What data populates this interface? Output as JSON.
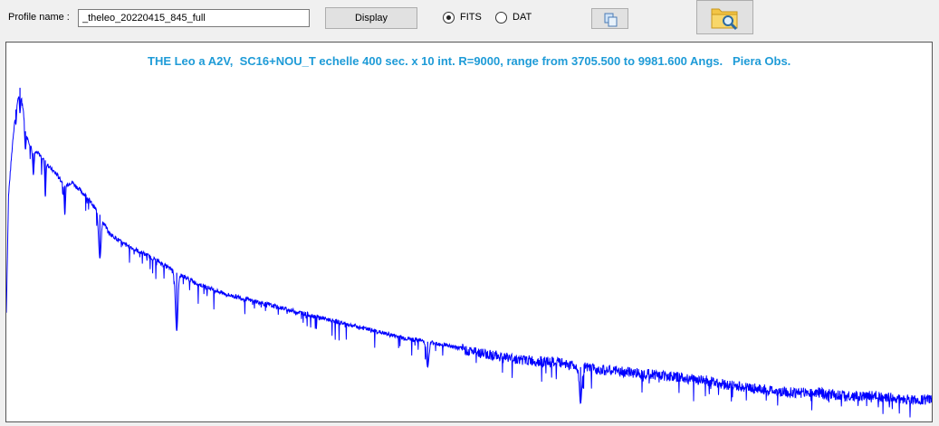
{
  "toolbar": {
    "profile_label": "Profile name :",
    "profile_value": "_theleo_20220415_845_full",
    "display_label": "Display",
    "fits_label": "FITS",
    "dat_label": "DAT",
    "format_selected": "FITS"
  },
  "colors": {
    "plot_title": "#1e9bd7",
    "spectrum": "#0000ff"
  },
  "plot": {
    "title": "THE Leo a A2V,  SC16+NOU_T echelle 400 sec. x 10 int. R=9000, range from 3705.500 to 9981.600 Angs.   Piera Obs."
  },
  "chart_data": {
    "type": "line",
    "title": "THE Leo a A2V,  SC16+NOU_T echelle 400 sec. x 10 int. R=9000, range from 3705.500 to 9981.600 Angs.   Piera Obs.",
    "xlabel": "",
    "ylabel": "",
    "xlim": [
      3705.5,
      9981.6
    ],
    "ylim": [
      0,
      1
    ],
    "grid": false,
    "series": [
      {
        "x": [
          3705.5,
          3720,
          3735,
          3750,
          3770,
          3798,
          3820,
          3835,
          3860,
          3889,
          3920,
          3970,
          4000,
          4050,
          4102,
          4150,
          4200,
          4250,
          4340,
          4400,
          4500,
          4600,
          4700,
          4861,
          5000,
          5200,
          5400,
          5600,
          5800,
          6000,
          6200,
          6400,
          6563,
          6700,
          6900,
          7200,
          7500,
          7600,
          7800,
          8100,
          8300,
          8500,
          8600,
          8800,
          9000,
          9200,
          9400,
          9600,
          9800,
          9981.6
        ],
        "y": [
          0.3,
          0.62,
          0.7,
          0.78,
          0.86,
          0.92,
          0.86,
          0.8,
          0.77,
          0.74,
          0.74,
          0.72,
          0.7,
          0.68,
          0.65,
          0.66,
          0.64,
          0.62,
          0.57,
          0.52,
          0.49,
          0.47,
          0.45,
          0.41,
          0.38,
          0.35,
          0.33,
          0.31,
          0.29,
          0.27,
          0.25,
          0.23,
          0.22,
          0.21,
          0.19,
          0.17,
          0.16,
          0.15,
          0.14,
          0.13,
          0.12,
          0.11,
          0.1,
          0.09,
          0.08,
          0.08,
          0.07,
          0.07,
          0.06,
          0.06
        ]
      }
    ],
    "absorption_lines": [
      {
        "x": 3770,
        "depth": 0.82
      },
      {
        "x": 3798,
        "depth": 0.85
      },
      {
        "x": 3835,
        "depth": 0.75
      },
      {
        "x": 3889,
        "depth": 0.68
      },
      {
        "x": 3970,
        "depth": 0.62
      },
      {
        "x": 4102,
        "depth": 0.57
      },
      {
        "x": 4340,
        "depth": 0.45
      },
      {
        "x": 4861,
        "depth": 0.25
      },
      {
        "x": 6563,
        "depth": 0.15
      },
      {
        "x": 7600,
        "depth": 0.05
      }
    ]
  }
}
